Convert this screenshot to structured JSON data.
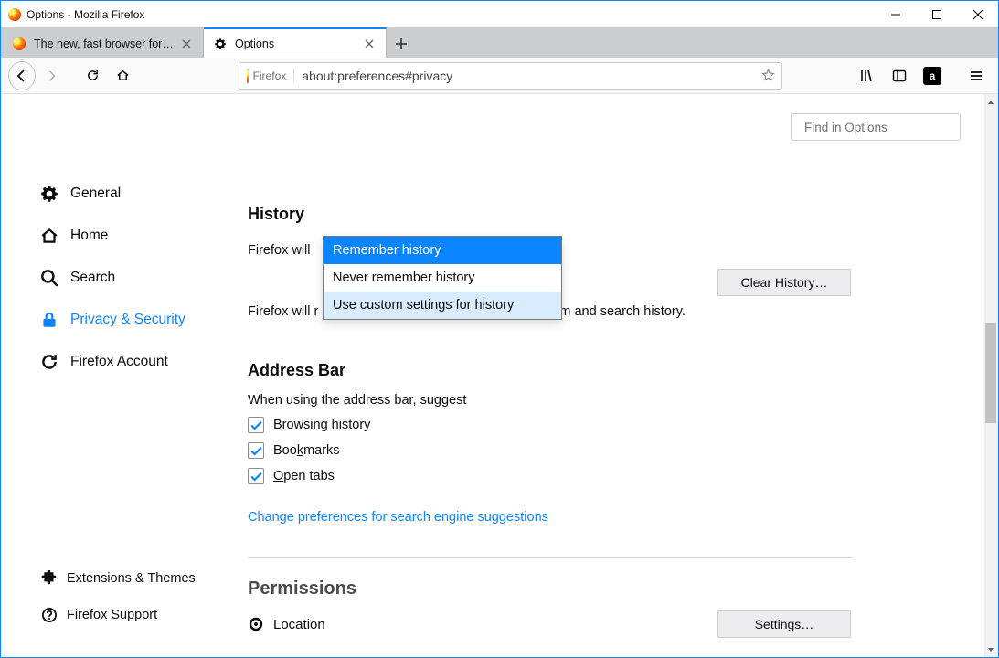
{
  "window": {
    "title": "Options - Mozilla Firefox"
  },
  "tabs": [
    {
      "title": "The new, fast browser for Mac,",
      "active": false
    },
    {
      "title": "Options",
      "active": true
    }
  ],
  "urlbar": {
    "identity_label": "Firefox",
    "value": "about:preferences#privacy"
  },
  "options_search": {
    "placeholder": "Find in Options"
  },
  "sidebar": {
    "categories": [
      {
        "id": "general",
        "label": "General"
      },
      {
        "id": "home",
        "label": "Home"
      },
      {
        "id": "search",
        "label": "Search"
      },
      {
        "id": "privacy",
        "label": "Privacy & Security",
        "active": true
      },
      {
        "id": "account",
        "label": "Firefox Account"
      }
    ],
    "footer": [
      {
        "id": "extensions",
        "label": "Extensions & Themes"
      },
      {
        "id": "support",
        "label": "Firefox Support"
      }
    ]
  },
  "history": {
    "heading": "History",
    "label": "Firefox will",
    "select_value": "Remember history",
    "options": [
      "Remember history",
      "Never remember history",
      "Use custom settings for history"
    ],
    "description_left": "Firefox will r",
    "description_right": "m and search history.",
    "clear_btn": "Clear History…"
  },
  "addressbar": {
    "heading": "Address Bar",
    "subtext": "When using the address bar, suggest",
    "checks": [
      {
        "label_pre": "Browsing ",
        "ak": "h",
        "label_post": "istory",
        "checked": true
      },
      {
        "label_pre": "Boo",
        "ak": "k",
        "label_post": "marks",
        "checked": true
      },
      {
        "label_pre": "",
        "ak": "O",
        "label_post": "pen tabs",
        "checked": true
      }
    ],
    "link": "Change preferences for search engine suggestions"
  },
  "permissions": {
    "heading": "Permissions",
    "items": [
      {
        "label": "Location",
        "button": "Settings…"
      }
    ]
  }
}
